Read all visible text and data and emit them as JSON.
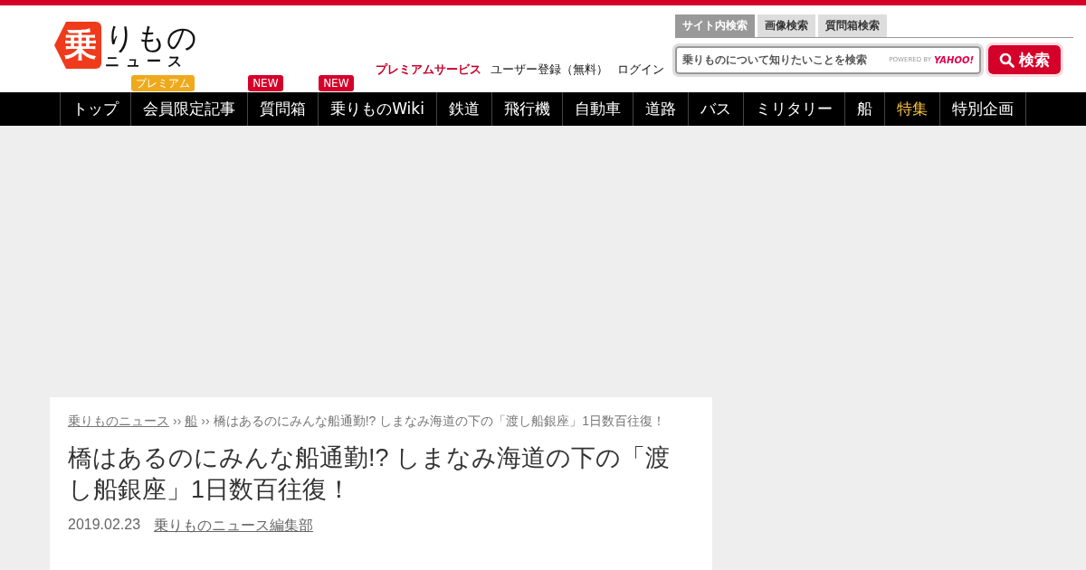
{
  "logo": {
    "mark": "乗",
    "text": "りもの",
    "subtext": "ニュース"
  },
  "header_links": [
    {
      "label": "プレミアムサービス",
      "kind": "premium"
    },
    {
      "label": "ユーザー登録（無料）",
      "kind": "plain"
    },
    {
      "label": "ログイン",
      "kind": "plain"
    }
  ],
  "search": {
    "tabs": [
      {
        "label": "サイト内検索",
        "selected": true
      },
      {
        "label": "画像検索",
        "selected": false
      },
      {
        "label": "質問箱検索",
        "selected": false
      }
    ],
    "placeholder": "乗りものについて知りたいことを検索",
    "powered_by": "POWERED BY",
    "provider": "YAHOO!",
    "button": "検索"
  },
  "nav": [
    {
      "label": "トップ",
      "highlighted": false
    },
    {
      "label": "会員限定記事",
      "badge": {
        "label": "プレミアム",
        "color": "#eeaa1c"
      },
      "highlighted": false
    },
    {
      "label": "質問箱",
      "badge": {
        "label": "NEW",
        "color": "#d4002a"
      },
      "highlighted": false
    },
    {
      "label": "乗りものWiki",
      "badge": {
        "label": "NEW",
        "color": "#d4002a"
      },
      "highlighted": false
    },
    {
      "label": "鉄道",
      "highlighted": false
    },
    {
      "label": "飛行機",
      "highlighted": false
    },
    {
      "label": "自動車",
      "highlighted": false
    },
    {
      "label": "道路",
      "highlighted": false
    },
    {
      "label": "バス",
      "highlighted": false
    },
    {
      "label": "ミリタリー",
      "highlighted": false
    },
    {
      "label": "船",
      "highlighted": false
    },
    {
      "label": "特集",
      "highlighted": true
    },
    {
      "label": "特別企画",
      "highlighted": false
    }
  ],
  "breadcrumb": {
    "links": [
      "乗りものニュース",
      "船"
    ],
    "current": "橋はあるのにみんな船通勤!? しまなみ海道の下の「渡し船銀座」1日数百往復！"
  },
  "breadcrumb_separator": "››",
  "article": {
    "title": "橋はあるのにみんな船通勤!? しまなみ海道の下の「渡し船銀座」1日数百往復！",
    "date": "2019.02.23",
    "author": "乗りものニュース編集部"
  }
}
